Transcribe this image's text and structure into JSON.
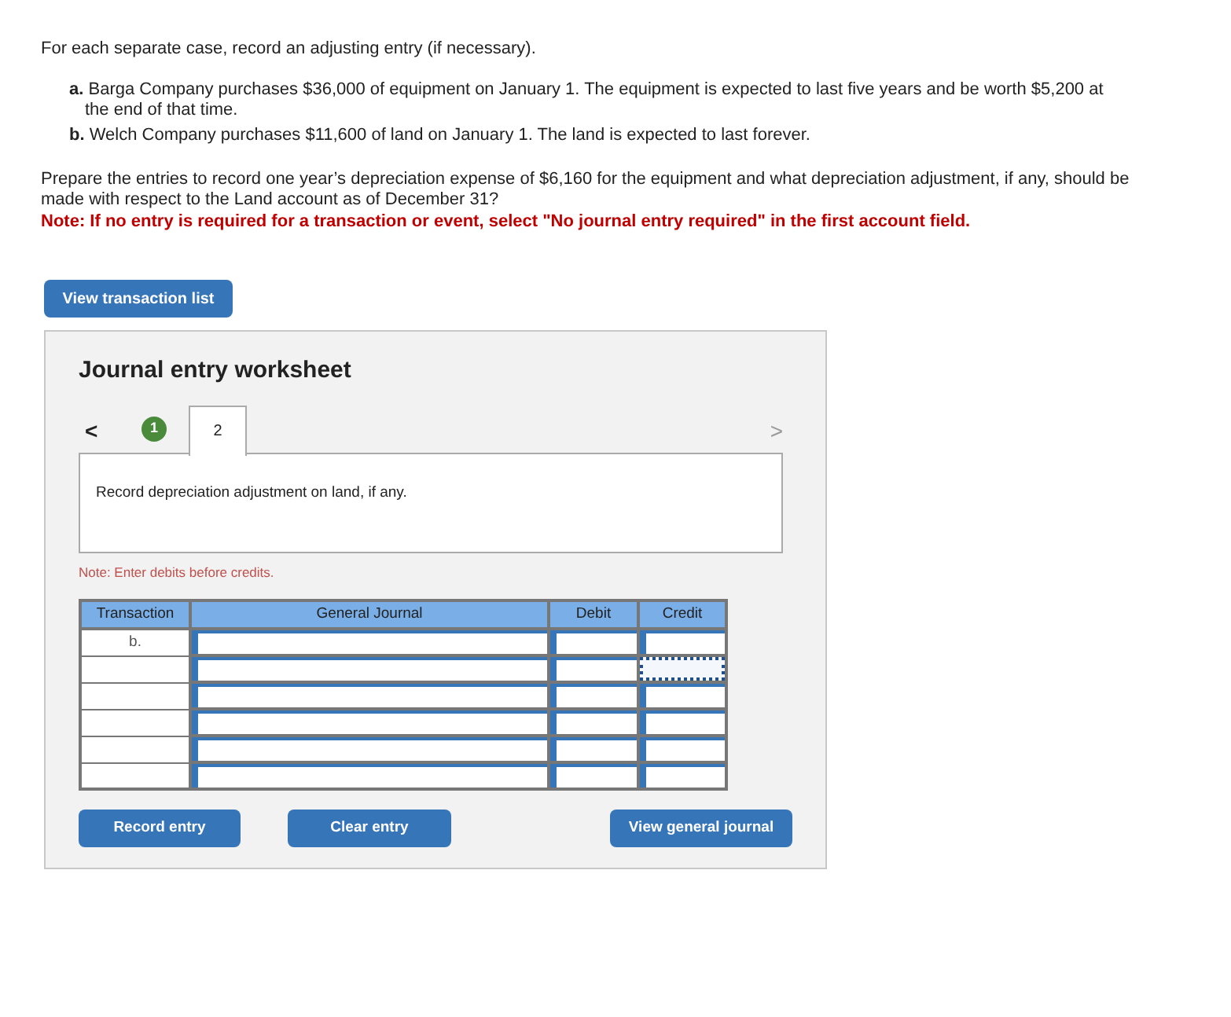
{
  "intro": "For each separate case, record an adjusting entry (if necessary).",
  "cases": [
    {
      "label": "a.",
      "text": "Barga Company purchases $36,000 of equipment on January 1. The equipment is expected to last five years and be worth $5,200 at the end of that time."
    },
    {
      "label": "b.",
      "text": "Welch Company purchases $11,600 of land on January 1. The land is expected to last forever."
    }
  ],
  "instructions": "Prepare the entries to record one year’s depreciation expense of $6,160 for the equipment and what depreciation adjustment, if any, should be made with respect to the Land account as of December 31?",
  "note": "Note: If no entry is required for a transaction or event, select \"No journal entry required\" in the first account field.",
  "view_transactions_button": "View transaction list",
  "worksheet": {
    "title": "Journal entry worksheet",
    "prev": "<",
    "next": ">",
    "tabs": [
      {
        "label": "1",
        "selected": false,
        "completed": true
      },
      {
        "label": "2",
        "selected": true,
        "completed": false
      }
    ],
    "prompt": "Record depreciation adjustment on land, if any.",
    "note": "Note: Enter debits before credits.",
    "table": {
      "columns": [
        "Transaction",
        "General Journal",
        "Debit",
        "Credit"
      ],
      "rows": [
        {
          "transaction": "b.",
          "credit_focused": false
        },
        {
          "credit_focused": true
        },
        {
          "credit_focused": false
        },
        {
          "credit_focused": false
        },
        {
          "credit_focused": false
        },
        {
          "credit_focused": false
        }
      ]
    },
    "buttons": [
      "Record entry",
      "Clear entry",
      "View general journal"
    ]
  }
}
